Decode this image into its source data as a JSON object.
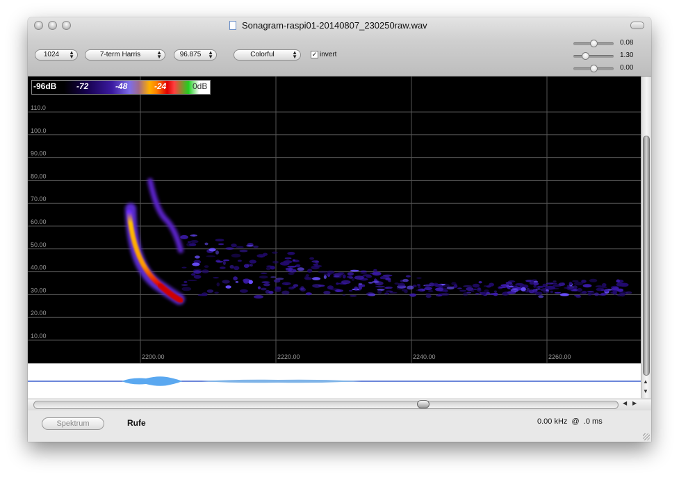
{
  "window": {
    "title": "Sonagram-raspi01-20140807_230250raw.wav"
  },
  "toolbar": {
    "fft_size": "1024",
    "window_function": "7-term Harris",
    "overlap": "96.875",
    "colormap": "Colorful",
    "invert_label": "invert",
    "invert_checked": true,
    "sliders": [
      {
        "value_label": "0.08",
        "level": 0.5
      },
      {
        "value_label": "1.30",
        "level": 0.3
      },
      {
        "value_label": "0.00",
        "level": 0.5
      }
    ]
  },
  "legend": {
    "labels": [
      "-96dB",
      "-72",
      "-48",
      "-24",
      "0dB"
    ]
  },
  "sonagram": {
    "y_ticks": [
      "110.0",
      "100.0",
      "90.00",
      "80.00",
      "70.00",
      "60.00",
      "50.00",
      "40.00",
      "30.00",
      "20.00",
      "10.00"
    ],
    "x_ticks": [
      "2200.00",
      "2220.00",
      "2240.00",
      "2260.00"
    ]
  },
  "bottom": {
    "spektrum_label": "Spektrum",
    "rufe_label": "Rufe",
    "status": "0.00 kHz  @  .0 ms"
  },
  "colors": {
    "background": "#000000",
    "waveform": "#5aa8f0",
    "baseline": "#3a5fcd"
  }
}
